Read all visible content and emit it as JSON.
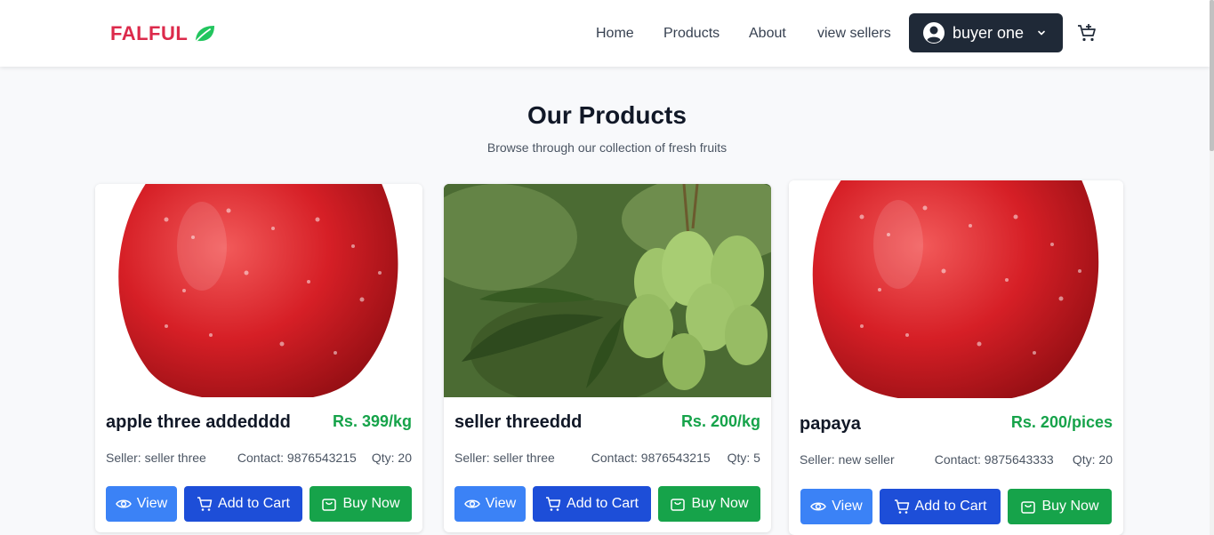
{
  "brand": {
    "name": "FALFUL",
    "icon": "leaf-icon",
    "color": "#dc2a4b"
  },
  "nav": {
    "links": [
      "Home",
      "Products",
      "About",
      "view sellers"
    ],
    "user_label": "buyer one",
    "cart_icon": "cart-add-icon"
  },
  "page": {
    "title": "Our Products",
    "subtitle": "Browse through our collection of fresh fruits"
  },
  "products": [
    {
      "name": "apple three addedddd",
      "price": "Rs. 399/kg",
      "seller": "Seller: seller three",
      "contact": "Contact: 9876543215",
      "qty": "Qty: 20",
      "image": "red-apple-image"
    },
    {
      "name": "seller threeddd",
      "price": "Rs. 200/kg",
      "seller": "Seller: seller three",
      "contact": "Contact: 9876543215",
      "qty": "Qty: 5",
      "image": "green-mangoes-image"
    },
    {
      "name": "papaya",
      "price": "Rs. 200/pices",
      "seller": "Seller: new seller",
      "contact": "Contact: 9875643333",
      "qty": "Qty: 20",
      "image": "red-apple-image"
    }
  ],
  "buttons": {
    "view": "View",
    "add_to_cart": "Add to Cart",
    "buy_now": "Buy Now"
  },
  "colors": {
    "primary_dark": "#1f2937",
    "view": "#3b82f6",
    "cart": "#1d4ed8",
    "buy": "#16a34a",
    "price": "#16a34a"
  }
}
